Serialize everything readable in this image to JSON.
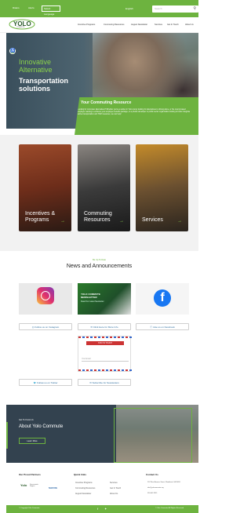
{
  "topbar": {
    "links": [
      "Riders",
      "Alerts"
    ],
    "select_label": "Select Language",
    "lang": "English",
    "search_placeholder": "Search"
  },
  "nav": {
    "logo_text": "YOLO",
    "logo_sub": "COMMUTE",
    "items": [
      "Incentive Programs",
      "Commuting Resources",
      "August Newsletter",
      "Services",
      "Get In Touch",
      "About Us"
    ]
  },
  "hero": {
    "line1": "Innovative",
    "line2": "Alternative",
    "line3": "Transportation solutions",
    "panel_title": "Your Commuting Resource",
    "panel_text": "Looking for commuter alternatives? Whether you're a worker in Yolo county looking for alternatives to driving alone, or the county-based employer wanting to enhance your employee benefits package, or a private developer or public sector organization looking to better integrate active transportation and TDM measures, we can help!"
  },
  "cards": [
    {
      "label": "Incentives & Programs"
    },
    {
      "label": "Commuting Resources"
    },
    {
      "label": "Services"
    }
  ],
  "news": {
    "eyebrow": "Be Up To Date",
    "title": "News and Announcements",
    "buttons": [
      "Follow us on Instagram",
      "Click Here for More Info",
      "Like us on Facebook",
      "Follow us on Twitter",
      "Subscribe for Newsletters"
    ],
    "banner_title": "YOLO COMMUTE NEWSLETTER",
    "banner_sub": "Read Our Latest Newsletter",
    "newsletter_label": "STAY IN TOUCH",
    "newsletter_field": "Your Email"
  },
  "about": {
    "eyebrow": "Get To Know Us",
    "title": "About Yolo Commute",
    "button": "Learn More"
  },
  "footer": {
    "partners_head": "Our Proud Partners",
    "partners": [
      "Yolo",
      "Sacramento Region",
      "SACOG"
    ],
    "links_head": "Quick links",
    "links_col1": [
      "Incentive Programs",
      "Commuting Resources",
      "August Newsletter"
    ],
    "links_col2": [
      "Services",
      "Get In Touch",
      "About Us"
    ],
    "contact_head": "Contact Us",
    "contact": [
      "292 West Beamer Street, Woodland, CA 95695",
      "info@yolocommute.org",
      "530.402.2819"
    ],
    "copyright": "© Copyright Yolo Commute",
    "rights": "© Yolo Commute All Rights Reserved"
  },
  "colors": {
    "brand_green": "#6db33f",
    "dark": "#33424f"
  }
}
